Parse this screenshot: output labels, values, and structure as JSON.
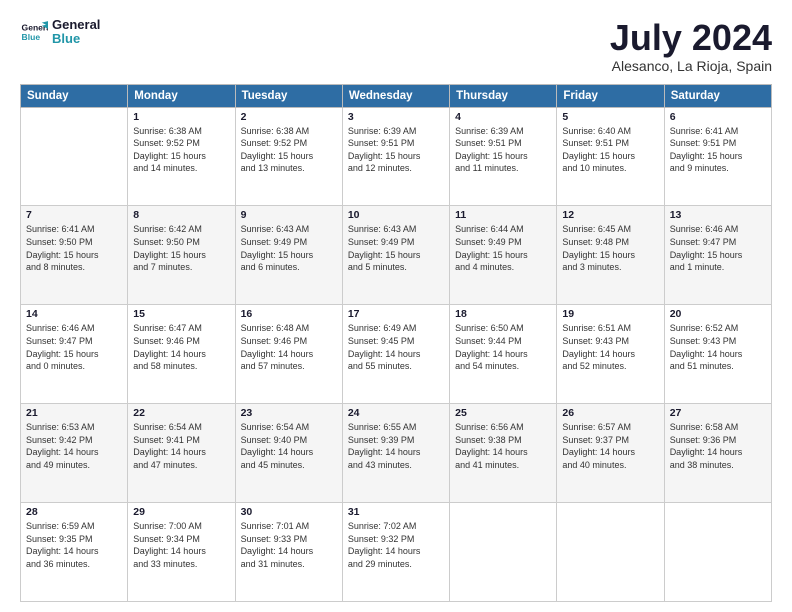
{
  "logo": {
    "line1": "General",
    "line2": "Blue"
  },
  "title": "July 2024",
  "location": "Alesanco, La Rioja, Spain",
  "days_header": [
    "Sunday",
    "Monday",
    "Tuesday",
    "Wednesday",
    "Thursday",
    "Friday",
    "Saturday"
  ],
  "weeks": [
    [
      {
        "day": "",
        "text": ""
      },
      {
        "day": "1",
        "text": "Sunrise: 6:38 AM\nSunset: 9:52 PM\nDaylight: 15 hours\nand 14 minutes."
      },
      {
        "day": "2",
        "text": "Sunrise: 6:38 AM\nSunset: 9:52 PM\nDaylight: 15 hours\nand 13 minutes."
      },
      {
        "day": "3",
        "text": "Sunrise: 6:39 AM\nSunset: 9:51 PM\nDaylight: 15 hours\nand 12 minutes."
      },
      {
        "day": "4",
        "text": "Sunrise: 6:39 AM\nSunset: 9:51 PM\nDaylight: 15 hours\nand 11 minutes."
      },
      {
        "day": "5",
        "text": "Sunrise: 6:40 AM\nSunset: 9:51 PM\nDaylight: 15 hours\nand 10 minutes."
      },
      {
        "day": "6",
        "text": "Sunrise: 6:41 AM\nSunset: 9:51 PM\nDaylight: 15 hours\nand 9 minutes."
      }
    ],
    [
      {
        "day": "7",
        "text": "Sunrise: 6:41 AM\nSunset: 9:50 PM\nDaylight: 15 hours\nand 8 minutes."
      },
      {
        "day": "8",
        "text": "Sunrise: 6:42 AM\nSunset: 9:50 PM\nDaylight: 15 hours\nand 7 minutes."
      },
      {
        "day": "9",
        "text": "Sunrise: 6:43 AM\nSunset: 9:49 PM\nDaylight: 15 hours\nand 6 minutes."
      },
      {
        "day": "10",
        "text": "Sunrise: 6:43 AM\nSunset: 9:49 PM\nDaylight: 15 hours\nand 5 minutes."
      },
      {
        "day": "11",
        "text": "Sunrise: 6:44 AM\nSunset: 9:49 PM\nDaylight: 15 hours\nand 4 minutes."
      },
      {
        "day": "12",
        "text": "Sunrise: 6:45 AM\nSunset: 9:48 PM\nDaylight: 15 hours\nand 3 minutes."
      },
      {
        "day": "13",
        "text": "Sunrise: 6:46 AM\nSunset: 9:47 PM\nDaylight: 15 hours\nand 1 minute."
      }
    ],
    [
      {
        "day": "14",
        "text": "Sunrise: 6:46 AM\nSunset: 9:47 PM\nDaylight: 15 hours\nand 0 minutes."
      },
      {
        "day": "15",
        "text": "Sunrise: 6:47 AM\nSunset: 9:46 PM\nDaylight: 14 hours\nand 58 minutes."
      },
      {
        "day": "16",
        "text": "Sunrise: 6:48 AM\nSunset: 9:46 PM\nDaylight: 14 hours\nand 57 minutes."
      },
      {
        "day": "17",
        "text": "Sunrise: 6:49 AM\nSunset: 9:45 PM\nDaylight: 14 hours\nand 55 minutes."
      },
      {
        "day": "18",
        "text": "Sunrise: 6:50 AM\nSunset: 9:44 PM\nDaylight: 14 hours\nand 54 minutes."
      },
      {
        "day": "19",
        "text": "Sunrise: 6:51 AM\nSunset: 9:43 PM\nDaylight: 14 hours\nand 52 minutes."
      },
      {
        "day": "20",
        "text": "Sunrise: 6:52 AM\nSunset: 9:43 PM\nDaylight: 14 hours\nand 51 minutes."
      }
    ],
    [
      {
        "day": "21",
        "text": "Sunrise: 6:53 AM\nSunset: 9:42 PM\nDaylight: 14 hours\nand 49 minutes."
      },
      {
        "day": "22",
        "text": "Sunrise: 6:54 AM\nSunset: 9:41 PM\nDaylight: 14 hours\nand 47 minutes."
      },
      {
        "day": "23",
        "text": "Sunrise: 6:54 AM\nSunset: 9:40 PM\nDaylight: 14 hours\nand 45 minutes."
      },
      {
        "day": "24",
        "text": "Sunrise: 6:55 AM\nSunset: 9:39 PM\nDaylight: 14 hours\nand 43 minutes."
      },
      {
        "day": "25",
        "text": "Sunrise: 6:56 AM\nSunset: 9:38 PM\nDaylight: 14 hours\nand 41 minutes."
      },
      {
        "day": "26",
        "text": "Sunrise: 6:57 AM\nSunset: 9:37 PM\nDaylight: 14 hours\nand 40 minutes."
      },
      {
        "day": "27",
        "text": "Sunrise: 6:58 AM\nSunset: 9:36 PM\nDaylight: 14 hours\nand 38 minutes."
      }
    ],
    [
      {
        "day": "28",
        "text": "Sunrise: 6:59 AM\nSunset: 9:35 PM\nDaylight: 14 hours\nand 36 minutes."
      },
      {
        "day": "29",
        "text": "Sunrise: 7:00 AM\nSunset: 9:34 PM\nDaylight: 14 hours\nand 33 minutes."
      },
      {
        "day": "30",
        "text": "Sunrise: 7:01 AM\nSunset: 9:33 PM\nDaylight: 14 hours\nand 31 minutes."
      },
      {
        "day": "31",
        "text": "Sunrise: 7:02 AM\nSunset: 9:32 PM\nDaylight: 14 hours\nand 29 minutes."
      },
      {
        "day": "",
        "text": ""
      },
      {
        "day": "",
        "text": ""
      },
      {
        "day": "",
        "text": ""
      }
    ]
  ]
}
